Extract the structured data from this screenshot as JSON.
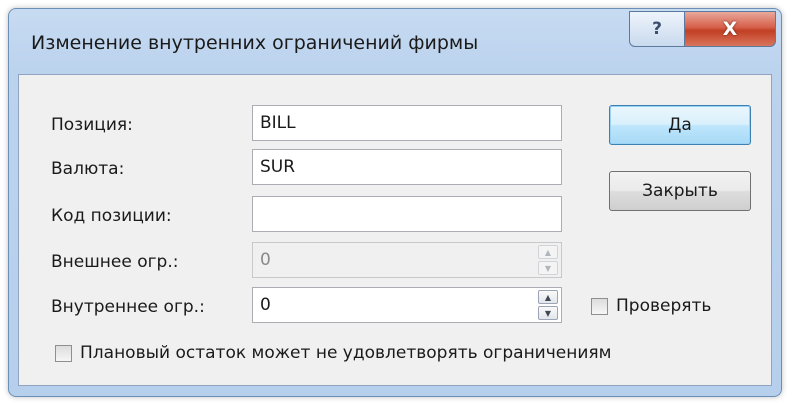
{
  "window": {
    "title": "Изменение внутренних ограничений фирмы",
    "help_glyph": "?",
    "close_glyph": "X"
  },
  "form": {
    "position_label": "Позиция:",
    "position_value": "BILL",
    "currency_label": "Валюта:",
    "currency_value": "SUR",
    "position_code_label": "Код позиции:",
    "position_code_value": "",
    "external_limit_label": "Внешнее огр.:",
    "external_limit_value": "0",
    "internal_limit_label": "Внутреннее огр.:",
    "internal_limit_value": "0"
  },
  "buttons": {
    "ok_label": "Да",
    "close_label": "Закрыть"
  },
  "checkboxes": {
    "check_label": "Проверять",
    "check_checked": false,
    "plan_label": "Плановый остаток может не удовлетворять ограничениям",
    "plan_checked": false
  },
  "icons": {
    "spin_up": "▲",
    "spin_down": "▼"
  }
}
